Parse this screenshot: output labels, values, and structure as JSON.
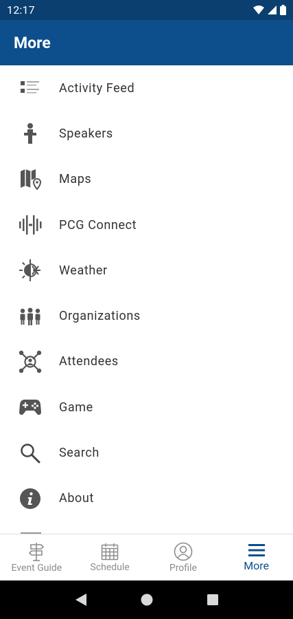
{
  "status_bar": {
    "time": "12:17"
  },
  "app_bar": {
    "title": "More"
  },
  "menu": {
    "items": [
      {
        "label": "Activity Feed",
        "icon": "activity-feed-icon"
      },
      {
        "label": "Speakers",
        "icon": "speaker-podium-icon"
      },
      {
        "label": "Maps",
        "icon": "map-pin-icon"
      },
      {
        "label": "PCG Connect",
        "icon": "pcg-connect-icon"
      },
      {
        "label": "Weather",
        "icon": "weather-sun-snow-icon"
      },
      {
        "label": "Organizations",
        "icon": "organizations-people-icon"
      },
      {
        "label": "Attendees",
        "icon": "attendees-network-icon"
      },
      {
        "label": "Game",
        "icon": "gamepad-icon"
      },
      {
        "label": "Search",
        "icon": "search-icon"
      },
      {
        "label": "About",
        "icon": "info-icon"
      }
    ]
  },
  "bottom_nav": {
    "items": [
      {
        "label": "Event Guide",
        "icon": "signpost-icon"
      },
      {
        "label": "Schedule",
        "icon": "calendar-icon"
      },
      {
        "label": "Profile",
        "icon": "profile-icon"
      },
      {
        "label": "More",
        "icon": "hamburger-menu-icon",
        "active": true
      }
    ]
  },
  "colors": {
    "status_bar": "#0a3f6f",
    "app_bar": "#0d4e8c",
    "active_nav": "#0d4e8c",
    "inactive_nav": "#8c8c8c",
    "icon_gray": "#555555"
  }
}
